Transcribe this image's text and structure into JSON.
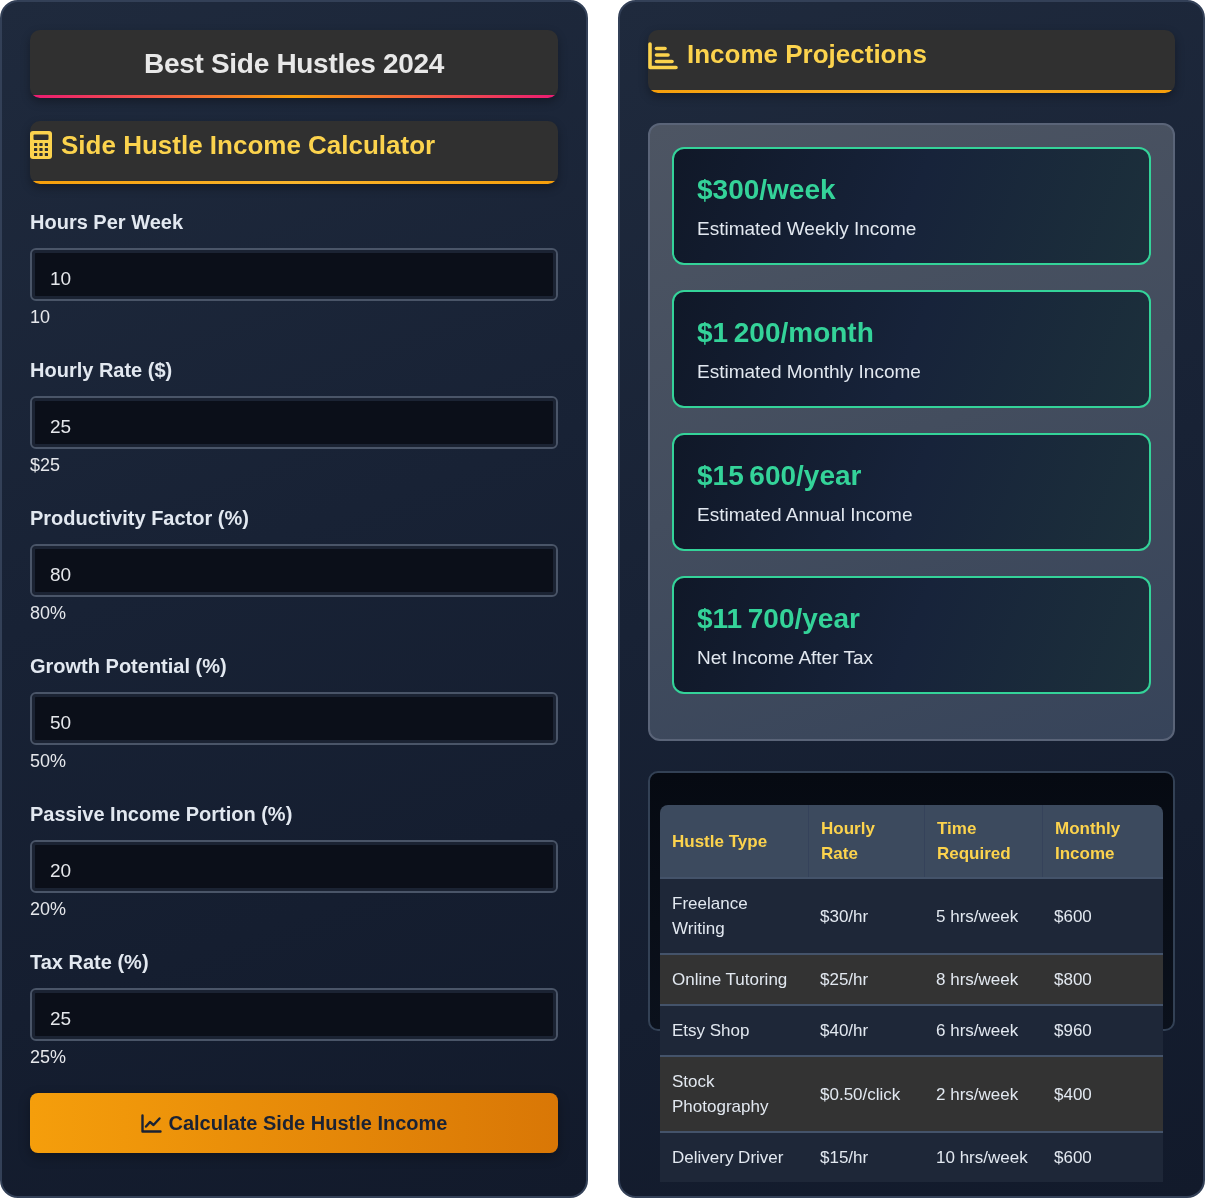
{
  "calculator": {
    "title": "Best Side Hustles 2024",
    "heading": "Side Hustle Income Calculator",
    "fields": [
      {
        "label": "Hours Per Week",
        "value": "10",
        "display": "10"
      },
      {
        "label": "Hourly Rate ($)",
        "value": "25",
        "display": "$25"
      },
      {
        "label": "Productivity Factor (%)",
        "value": "80",
        "display": "80%"
      },
      {
        "label": "Growth Potential (%)",
        "value": "50",
        "display": "50%"
      },
      {
        "label": "Passive Income Portion (%)",
        "value": "20",
        "display": "20%"
      },
      {
        "label": "Tax Rate (%)",
        "value": "25",
        "display": "25%"
      }
    ],
    "button": "Calculate Side Hustle Income"
  },
  "projections": {
    "heading": "Income Projections",
    "results": [
      {
        "value": "$300/week",
        "label": "Estimated Weekly Income"
      },
      {
        "value": "$1 200/month",
        "label": "Estimated Monthly Income"
      },
      {
        "value": "$15 600/year",
        "label": "Estimated Annual Income"
      },
      {
        "value": "$11 700/year",
        "label": "Net Income After Tax"
      }
    ],
    "table": {
      "columns": [
        "Hustle Type",
        "Hourly Rate",
        "Time Required",
        "Monthly Income"
      ],
      "rows": [
        [
          "Freelance Writing",
          "$30/hr",
          "5 hrs/week",
          "$600"
        ],
        [
          "Online Tutoring",
          "$25/hr",
          "8 hrs/week",
          "$800"
        ],
        [
          "Etsy Shop",
          "$40/hr",
          "6 hrs/week",
          "$960"
        ],
        [
          "Stock Photography",
          "$0.50/click",
          "2 hrs/week",
          "$400"
        ],
        [
          "Delivery Driver",
          "$15/hr",
          "10 hrs/week",
          "$600"
        ]
      ]
    }
  }
}
